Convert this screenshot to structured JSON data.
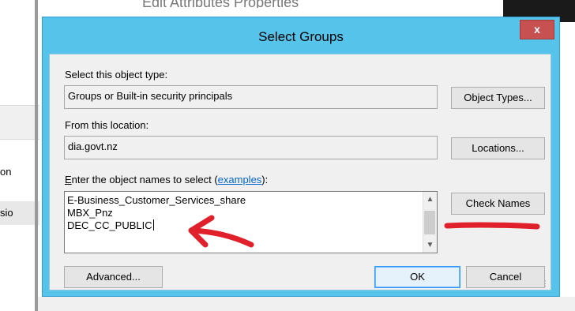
{
  "background": {
    "left_text_1": "on",
    "left_text_2": "sio",
    "window_title_fragment": "Edit Attributes Properties"
  },
  "dialog": {
    "title": "Select Groups",
    "close_label": "x",
    "object_type_label": "Select this object type:",
    "object_type_value": "Groups or Built-in security principals",
    "object_types_button": "Object Types...",
    "location_label": "From this location:",
    "location_value": "dia.govt.nz",
    "locations_button": "Locations...",
    "names_label_prefix": "Enter the object names to select (",
    "names_label_underlined_letter": "E",
    "names_label_rest": "nter the object names to select (",
    "examples_link": "examples",
    "names_label_suffix": "):",
    "names": [
      "E-Business_Customer_Services_share",
      "MBX_Pnz",
      "DEC_CC_PUBLIC"
    ],
    "check_names_button": "Check Names",
    "advanced_button": "Advanced...",
    "ok_button": "OK",
    "cancel_button": "Cancel"
  },
  "colors": {
    "title_bar": "#56c3ea",
    "close_button": "#c75050",
    "annotation": "#e0202a"
  }
}
